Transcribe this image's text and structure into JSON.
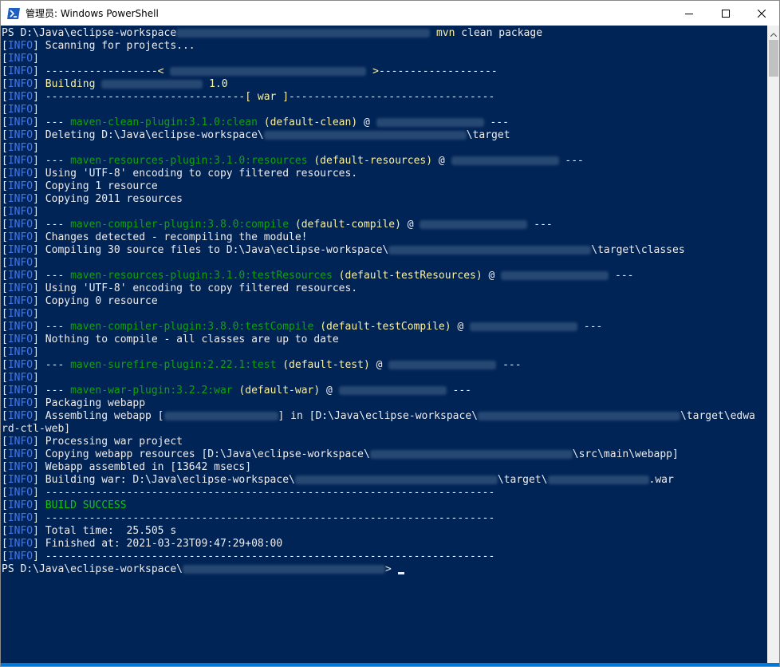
{
  "window": {
    "title": "管理员: Windows PowerShell",
    "minimize_icon": "minimize-icon",
    "maximize_icon": "maximize-icon",
    "close_icon": "close-icon"
  },
  "colors": {
    "console_background": "#012456",
    "text_default": "#eeedf0",
    "text_yellow": "#f9f1a5",
    "text_green": "#13a10e",
    "text_success": "#16c60c",
    "text_info_tag": "#3b78ff"
  },
  "console": {
    "lines": [
      {
        "segments": [
          {
            "t": "PS D:\\Java\\eclipse-workspace"
          },
          {
            "blur": 40
          },
          {
            "t": " "
          },
          {
            "t": "mvn",
            "c": "y"
          },
          {
            "t": " clean package"
          }
        ]
      },
      {
        "segments": [
          {
            "t": "["
          },
          {
            "t": "INFO",
            "c": "b"
          },
          {
            "t": "] Scanning for projects..."
          }
        ]
      },
      {
        "segments": [
          {
            "t": "["
          },
          {
            "t": "INFO",
            "c": "b"
          },
          {
            "t": "]"
          }
        ]
      },
      {
        "segments": [
          {
            "t": "["
          },
          {
            "t": "INFO",
            "c": "b"
          },
          {
            "t": "] "
          },
          {
            "t": "------------------< ",
            "c": "y"
          },
          {
            "blur": 31
          },
          {
            "t": " >-------------------",
            "c": "y"
          }
        ]
      },
      {
        "segments": [
          {
            "t": "["
          },
          {
            "t": "INFO",
            "c": "b"
          },
          {
            "t": "] "
          },
          {
            "t": "Building ",
            "c": "y"
          },
          {
            "blur": 16
          },
          {
            "t": " 1.0",
            "c": "y"
          }
        ]
      },
      {
        "segments": [
          {
            "t": "["
          },
          {
            "t": "INFO",
            "c": "b"
          },
          {
            "t": "] "
          },
          {
            "t": "--------------------------------[ war ]---------------------------------",
            "c": "y"
          }
        ]
      },
      {
        "segments": [
          {
            "t": "["
          },
          {
            "t": "INFO",
            "c": "b"
          },
          {
            "t": "]"
          }
        ]
      },
      {
        "segments": [
          {
            "t": "["
          },
          {
            "t": "INFO",
            "c": "b"
          },
          {
            "t": "] --- "
          },
          {
            "t": "maven-clean-plugin:3.1.0:clean",
            "c": "g"
          },
          {
            "t": " "
          },
          {
            "t": "(default-clean)",
            "c": "y"
          },
          {
            "t": " @ "
          },
          {
            "blur": 17
          },
          {
            "t": " ---"
          }
        ]
      },
      {
        "segments": [
          {
            "t": "["
          },
          {
            "t": "INFO",
            "c": "b"
          },
          {
            "t": "] Deleting D:\\Java\\eclipse-workspace\\"
          },
          {
            "blur": 32
          },
          {
            "t": "\\target"
          }
        ]
      },
      {
        "segments": [
          {
            "t": "["
          },
          {
            "t": "INFO",
            "c": "b"
          },
          {
            "t": "]"
          }
        ]
      },
      {
        "segments": [
          {
            "t": "["
          },
          {
            "t": "INFO",
            "c": "b"
          },
          {
            "t": "] --- "
          },
          {
            "t": "maven-resources-plugin:3.1.0:resources",
            "c": "g"
          },
          {
            "t": " "
          },
          {
            "t": "(default-resources)",
            "c": "y"
          },
          {
            "t": " @ "
          },
          {
            "blur": 17
          },
          {
            "t": " ---"
          }
        ]
      },
      {
        "segments": [
          {
            "t": "["
          },
          {
            "t": "INFO",
            "c": "b"
          },
          {
            "t": "] Using 'UTF-8' encoding to copy filtered resources."
          }
        ]
      },
      {
        "segments": [
          {
            "t": "["
          },
          {
            "t": "INFO",
            "c": "b"
          },
          {
            "t": "] Copying 1 resource"
          }
        ]
      },
      {
        "segments": [
          {
            "t": "["
          },
          {
            "t": "INFO",
            "c": "b"
          },
          {
            "t": "] Copying 2011 resources"
          }
        ]
      },
      {
        "segments": [
          {
            "t": "["
          },
          {
            "t": "INFO",
            "c": "b"
          },
          {
            "t": "]"
          }
        ]
      },
      {
        "segments": [
          {
            "t": "["
          },
          {
            "t": "INFO",
            "c": "b"
          },
          {
            "t": "] --- "
          },
          {
            "t": "maven-compiler-plugin:3.8.0:compile",
            "c": "g"
          },
          {
            "t": " "
          },
          {
            "t": "(default-compile)",
            "c": "y"
          },
          {
            "t": " @ "
          },
          {
            "blur": 17
          },
          {
            "t": " ---"
          }
        ]
      },
      {
        "segments": [
          {
            "t": "["
          },
          {
            "t": "INFO",
            "c": "b"
          },
          {
            "t": "] Changes detected - recompiling the module!"
          }
        ]
      },
      {
        "segments": [
          {
            "t": "["
          },
          {
            "t": "INFO",
            "c": "b"
          },
          {
            "t": "] Compiling 30 source files to D:\\Java\\eclipse-workspace\\"
          },
          {
            "blur": 32
          },
          {
            "t": "\\target\\classes"
          }
        ]
      },
      {
        "segments": [
          {
            "t": "["
          },
          {
            "t": "INFO",
            "c": "b"
          },
          {
            "t": "]"
          }
        ]
      },
      {
        "segments": [
          {
            "t": "["
          },
          {
            "t": "INFO",
            "c": "b"
          },
          {
            "t": "] --- "
          },
          {
            "t": "maven-resources-plugin:3.1.0:testResources",
            "c": "g"
          },
          {
            "t": " "
          },
          {
            "t": "(default-testResources)",
            "c": "y"
          },
          {
            "t": " @ "
          },
          {
            "blur": 17
          },
          {
            "t": " ---"
          }
        ]
      },
      {
        "segments": [
          {
            "t": "["
          },
          {
            "t": "INFO",
            "c": "b"
          },
          {
            "t": "] Using 'UTF-8' encoding to copy filtered resources."
          }
        ]
      },
      {
        "segments": [
          {
            "t": "["
          },
          {
            "t": "INFO",
            "c": "b"
          },
          {
            "t": "] Copying 0 resource"
          }
        ]
      },
      {
        "segments": [
          {
            "t": "["
          },
          {
            "t": "INFO",
            "c": "b"
          },
          {
            "t": "]"
          }
        ]
      },
      {
        "segments": [
          {
            "t": "["
          },
          {
            "t": "INFO",
            "c": "b"
          },
          {
            "t": "] --- "
          },
          {
            "t": "maven-compiler-plugin:3.8.0:testCompile",
            "c": "g"
          },
          {
            "t": " "
          },
          {
            "t": "(default-testCompile)",
            "c": "y"
          },
          {
            "t": " @ "
          },
          {
            "blur": 17
          },
          {
            "t": " ---"
          }
        ]
      },
      {
        "segments": [
          {
            "t": "["
          },
          {
            "t": "INFO",
            "c": "b"
          },
          {
            "t": "] Nothing to compile - all classes are up to date"
          }
        ]
      },
      {
        "segments": [
          {
            "t": "["
          },
          {
            "t": "INFO",
            "c": "b"
          },
          {
            "t": "]"
          }
        ]
      },
      {
        "segments": [
          {
            "t": "["
          },
          {
            "t": "INFO",
            "c": "b"
          },
          {
            "t": "] --- "
          },
          {
            "t": "maven-surefire-plugin:2.22.1:test",
            "c": "g"
          },
          {
            "t": " "
          },
          {
            "t": "(default-test)",
            "c": "y"
          },
          {
            "t": " @ "
          },
          {
            "blur": 17
          },
          {
            "t": " ---"
          }
        ]
      },
      {
        "segments": [
          {
            "t": "["
          },
          {
            "t": "INFO",
            "c": "b"
          },
          {
            "t": "]"
          }
        ]
      },
      {
        "segments": [
          {
            "t": "["
          },
          {
            "t": "INFO",
            "c": "b"
          },
          {
            "t": "] --- "
          },
          {
            "t": "maven-war-plugin:3.2.2:war",
            "c": "g"
          },
          {
            "t": " "
          },
          {
            "t": "(default-war)",
            "c": "y"
          },
          {
            "t": " @ "
          },
          {
            "blur": 17
          },
          {
            "t": " ---"
          }
        ]
      },
      {
        "segments": [
          {
            "t": "["
          },
          {
            "t": "INFO",
            "c": "b"
          },
          {
            "t": "] Packaging webapp"
          }
        ]
      },
      {
        "segments": [
          {
            "t": "["
          },
          {
            "t": "INFO",
            "c": "b"
          },
          {
            "t": "] Assembling webapp ["
          },
          {
            "blur": 18
          },
          {
            "t": "] in [D:\\Java\\eclipse-workspace\\"
          },
          {
            "blur": 32
          },
          {
            "t": "\\target\\edwa"
          }
        ]
      },
      {
        "segments": [
          {
            "t": "rd-ctl-web]"
          }
        ]
      },
      {
        "segments": [
          {
            "t": "["
          },
          {
            "t": "INFO",
            "c": "b"
          },
          {
            "t": "] Processing war project"
          }
        ]
      },
      {
        "segments": [
          {
            "t": "["
          },
          {
            "t": "INFO",
            "c": "b"
          },
          {
            "t": "] Copying webapp resources [D:\\Java\\eclipse-workspace\\"
          },
          {
            "blur": 32
          },
          {
            "t": "\\src\\main\\webapp]"
          }
        ]
      },
      {
        "segments": [
          {
            "t": "["
          },
          {
            "t": "INFO",
            "c": "b"
          },
          {
            "t": "] Webapp assembled in [13642 msecs]"
          }
        ]
      },
      {
        "segments": [
          {
            "t": "["
          },
          {
            "t": "INFO",
            "c": "b"
          },
          {
            "t": "] Building war: D:\\Java\\eclipse-workspace\\"
          },
          {
            "blur": 32
          },
          {
            "t": "\\target\\"
          },
          {
            "blur": 16
          },
          {
            "t": ".war"
          }
        ]
      },
      {
        "segments": [
          {
            "t": "["
          },
          {
            "t": "INFO",
            "c": "b"
          },
          {
            "t": "] ------------------------------------------------------------------------",
            "c": "y"
          }
        ]
      },
      {
        "segments": [
          {
            "t": "["
          },
          {
            "t": "INFO",
            "c": "b"
          },
          {
            "t": "] "
          },
          {
            "t": "BUILD SUCCESS",
            "c": "lg"
          }
        ]
      },
      {
        "segments": [
          {
            "t": "["
          },
          {
            "t": "INFO",
            "c": "b"
          },
          {
            "t": "] ------------------------------------------------------------------------",
            "c": "y"
          }
        ]
      },
      {
        "segments": [
          {
            "t": "["
          },
          {
            "t": "INFO",
            "c": "b"
          },
          {
            "t": "] Total time:  25.505 s"
          }
        ]
      },
      {
        "segments": [
          {
            "t": "["
          },
          {
            "t": "INFO",
            "c": "b"
          },
          {
            "t": "] Finished at: 2021-03-23T09:47:29+08:00"
          }
        ]
      },
      {
        "segments": [
          {
            "t": "["
          },
          {
            "t": "INFO",
            "c": "b"
          },
          {
            "t": "] ------------------------------------------------------------------------",
            "c": "y"
          }
        ]
      },
      {
        "segments": [
          {
            "t": "PS D:\\Java\\eclipse-workspace\\"
          },
          {
            "blur": 32
          },
          {
            "t": "> "
          }
        ],
        "cursor": true
      }
    ]
  }
}
